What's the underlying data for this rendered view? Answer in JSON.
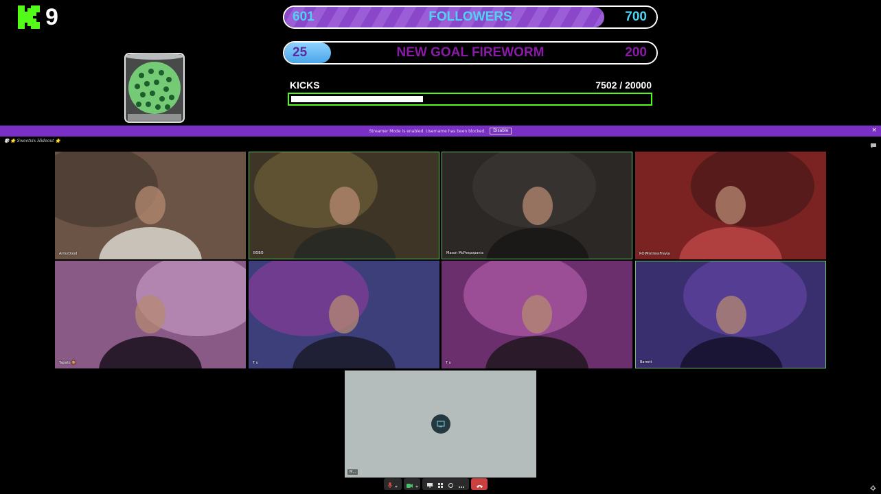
{
  "logo": {
    "number": "9"
  },
  "goals": {
    "followers": {
      "current": "601",
      "label": "FOLLOWERS",
      "target": "700",
      "progress": 0.86
    },
    "fireworm": {
      "current": "25",
      "label": "NEW GOAL FIREWORM",
      "target": "200",
      "progress": 0.125
    }
  },
  "kicks": {
    "label": "KICKS",
    "count": "7502  / 20000",
    "progress": 0.375
  },
  "banner": {
    "message": "Streamer Mode is enabled. Username has been blocked.",
    "button": "Disable"
  },
  "room": {
    "title": "🎲 🌟 Sweetvix Hideout 🌟"
  },
  "participants": [
    {
      "name": "ArmyDood",
      "speaking": false,
      "palette": [
        "#6b5446",
        "#3d2f2a",
        "#c9c2b8"
      ]
    },
    {
      "name": "BOBO",
      "speaking": true,
      "palette": [
        "#3f3526",
        "#7a6a3c",
        "#2a2a24"
      ]
    },
    {
      "name": "Mason McPeepopants",
      "speaking": true,
      "palette": [
        "#2b2826",
        "#3e3a37",
        "#1a1918"
      ]
    },
    {
      "name": "RO|MistressFreyja",
      "speaking": false,
      "palette": [
        "#7a2322",
        "#3a1515",
        "#b04040"
      ]
    },
    {
      "name": "Tapato 🍪",
      "speaking": false,
      "palette": [
        "#8a5a86",
        "#d3a9d4",
        "#2a1b2c"
      ]
    },
    {
      "name": "T u",
      "speaking": false,
      "palette": [
        "#3d3f7a",
        "#9a3aa0",
        "#1f1f35"
      ]
    },
    {
      "name": "T u",
      "speaking": false,
      "palette": [
        "#6b2f6e",
        "#c367b6",
        "#2a1a2a"
      ]
    },
    {
      "name": "Barrett",
      "speaking": true,
      "palette": [
        "#3a2f6e",
        "#6a48b0",
        "#1a1535"
      ]
    }
  ],
  "screenshare": {
    "label": "M..."
  },
  "icons": [
    "kick-logo-icon",
    "jar-icon",
    "chat-icon",
    "screenshare-icon",
    "mic-icon",
    "camera-icon",
    "share-screen-icon",
    "grid-icon",
    "whiteboard-icon",
    "more-icon",
    "leave-icon",
    "settings-icon"
  ],
  "colors": {
    "kick_green": "#53fc18",
    "banner_purple": "#7a30c4",
    "followers_text": "#4fd3f2",
    "fireworm_text": "#8a1aa8",
    "leave_red": "#c9403f"
  }
}
